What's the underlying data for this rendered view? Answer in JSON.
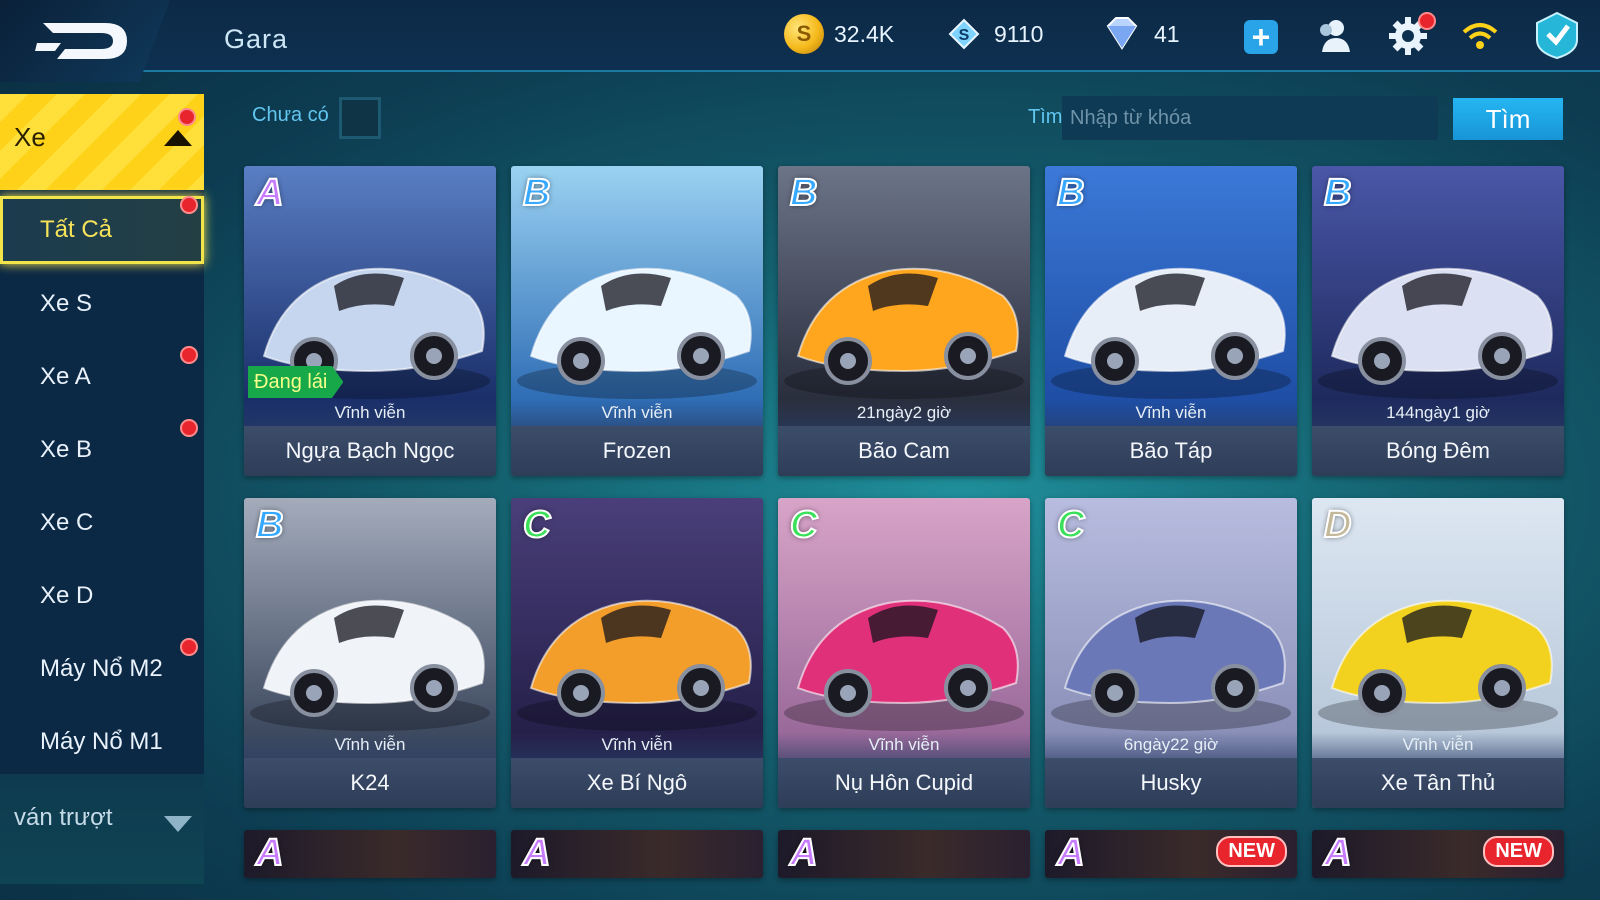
{
  "header": {
    "title": "Gara",
    "gold": "32.4K",
    "chips": "9110",
    "gems": "41"
  },
  "filters": {
    "owned_label": "Chưa có",
    "search_label": "Tìm",
    "search_placeholder": "Nhập từ khóa",
    "search_button": "Tìm"
  },
  "sidebar": {
    "category": "Xe",
    "items": [
      {
        "label": "Tất Cả",
        "active": true,
        "dot": true
      },
      {
        "label": "Xe S",
        "active": false,
        "dot": false
      },
      {
        "label": "Xe A",
        "active": false,
        "dot": true
      },
      {
        "label": "Xe B",
        "active": false,
        "dot": true
      },
      {
        "label": "Xe C",
        "active": false,
        "dot": false
      },
      {
        "label": "Xe D",
        "active": false,
        "dot": false
      },
      {
        "label": "Máy Nổ M2",
        "active": false,
        "dot": true
      },
      {
        "label": "Máy Nổ M1",
        "active": false,
        "dot": false
      }
    ],
    "bottom_category": "ván trượt"
  },
  "cars": [
    {
      "tier": "A",
      "duration": "Vĩnh viễn",
      "name": "Ngựa Bạch Ngọc",
      "badge": "Đang lái",
      "art": "blue-silver"
    },
    {
      "tier": "B",
      "duration": "Vĩnh viễn",
      "name": "Frozen",
      "art": "ice"
    },
    {
      "tier": "B",
      "duration": "21ngày2 giờ",
      "name": "Bão Cam",
      "art": "orange"
    },
    {
      "tier": "B",
      "duration": "Vĩnh viễn",
      "name": "Bão Táp",
      "art": "blue-white"
    },
    {
      "tier": "B",
      "duration": "144ngày1 giờ",
      "name": "Bóng Đêm",
      "art": "purple-night"
    },
    {
      "tier": "B",
      "duration": "Vĩnh viễn",
      "name": "K24",
      "art": "white-silver"
    },
    {
      "tier": "C",
      "duration": "Vĩnh viễn",
      "name": "Xe Bí Ngô",
      "art": "pumpkin"
    },
    {
      "tier": "C",
      "duration": "Vĩnh viễn",
      "name": "Nụ Hôn Cupid",
      "art": "pink"
    },
    {
      "tier": "C",
      "duration": "6ngày22 giờ",
      "name": "Husky",
      "art": "husky"
    },
    {
      "tier": "D",
      "duration": "Vĩnh viễn",
      "name": "Xe Tân Thủ",
      "art": "kart"
    }
  ],
  "partial_row": [
    {
      "tier": "A",
      "new": ""
    },
    {
      "tier": "A",
      "new": ""
    },
    {
      "tier": "A",
      "new": ""
    },
    {
      "tier": "A",
      "new": "NEW"
    },
    {
      "tier": "A",
      "new": "NEW"
    }
  ],
  "colors": {
    "accent": "#25b6f2",
    "sidebar_active": "#f2e54a",
    "notification": "#e8252d"
  }
}
